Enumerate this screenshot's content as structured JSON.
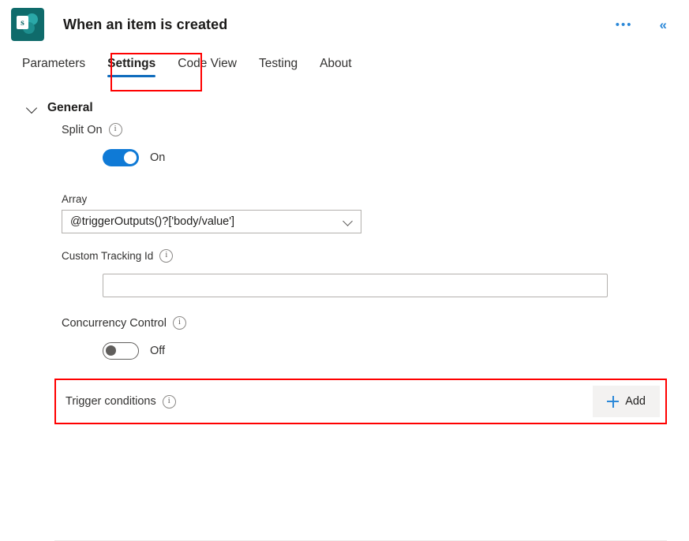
{
  "header": {
    "title": "When an item is created",
    "app_icon_letter": "s",
    "app_icon_name": "sharepoint-icon",
    "more_label": "•••",
    "collapse_label": "«",
    "accent_color": "#0f6cbd",
    "icon_bg_color": "#0f6b6b"
  },
  "tabs": [
    {
      "label": "Parameters",
      "active": false
    },
    {
      "label": "Settings",
      "active": true
    },
    {
      "label": "Code View",
      "active": false
    },
    {
      "label": "Testing",
      "active": false
    },
    {
      "label": "About",
      "active": false
    }
  ],
  "annotations": {
    "color": "#ff0000",
    "settings_tab_box": true,
    "trigger_conditions_box": true
  },
  "section": {
    "title": "General",
    "expanded": true
  },
  "fields": {
    "split_on": {
      "label": "Split On",
      "info": "i",
      "toggle_state": "On",
      "toggle_on": true
    },
    "array": {
      "label": "Array",
      "value": "@triggerOutputs()?['body/value']",
      "placeholder": ""
    },
    "custom_tracking_id": {
      "label": "Custom Tracking Id",
      "info": "i",
      "value": "",
      "placeholder": ""
    },
    "concurrency_control": {
      "label": "Concurrency Control",
      "info": "i",
      "toggle_state": "Off",
      "toggle_on": false
    },
    "trigger_conditions": {
      "label": "Trigger conditions",
      "info": "i",
      "add_label": "Add"
    }
  }
}
